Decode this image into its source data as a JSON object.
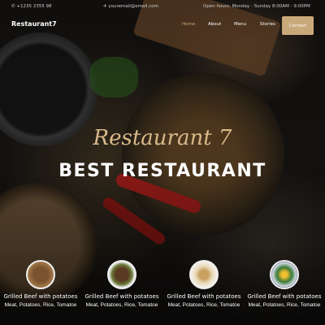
{
  "topbar": {
    "phone": "+1235 2355 98",
    "email": "youremail@email.com",
    "hours": "Open hours: Monday - Sunday 8:00AM - 9:00PM"
  },
  "nav": {
    "brand": "Restaurant7",
    "items": [
      "Home",
      "About",
      "Menu",
      "Stories"
    ],
    "contact": "Contact"
  },
  "hero": {
    "script": "Restaurant 7",
    "title": "BEST RESTAURANT"
  },
  "menu": [
    {
      "name": "Grilled Beef with potatoes",
      "desc": "Meat, Potatoes, Rice, Tomatoe"
    },
    {
      "name": "Grilled Beef with potatoes",
      "desc": "Meat, Potatoes, Rice, Tomatoe"
    },
    {
      "name": "Grilled Beef with potatoes",
      "desc": "Meat, Potatoes, Rice, Tomatoe"
    },
    {
      "name": "Grilled Beef with potatoes",
      "desc": "Meat, Potatoes, Rice, Tomatoe"
    }
  ],
  "colors": {
    "accent": "#c9a97a"
  }
}
